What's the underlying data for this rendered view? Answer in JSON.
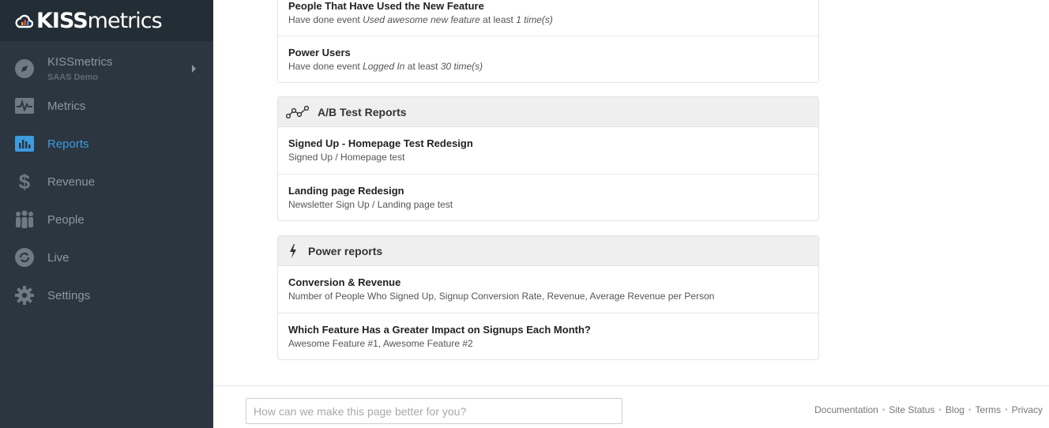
{
  "brand": {
    "name_bold": "KISS",
    "name_light": "metrics"
  },
  "sidebar": {
    "account": {
      "name": "KISSmetrics",
      "sub": "SAAS Demo"
    },
    "items": [
      {
        "label": "Metrics",
        "icon": "metrics-icon"
      },
      {
        "label": "Reports",
        "icon": "reports-icon",
        "active": true
      },
      {
        "label": "Revenue",
        "icon": "dollar-icon"
      },
      {
        "label": "People",
        "icon": "people-icon"
      },
      {
        "label": "Live",
        "icon": "live-icon"
      },
      {
        "label": "Settings",
        "icon": "gear-icon"
      }
    ],
    "colors": {
      "bg": "#2b3640",
      "active": "#3d9be0",
      "text": "#8c979f"
    }
  },
  "segments": {
    "rows": [
      {
        "title": "People That Have Used the New Feature",
        "pre": "Have done event ",
        "event": "Used awesome new feature",
        "mid": " at least ",
        "count": "1 time(s)"
      },
      {
        "title": "Power Users",
        "pre": "Have done event ",
        "event": "Logged In",
        "mid": " at least ",
        "count": "30 time(s)"
      }
    ]
  },
  "ab_tests": {
    "title": "A/B Test Reports",
    "rows": [
      {
        "title": "Signed Up - Homepage Test Redesign",
        "desc": "Signed Up / Homepage test"
      },
      {
        "title": "Landing page Redesign",
        "desc": "Newsletter Sign Up / Landing page test"
      }
    ]
  },
  "power_reports": {
    "title": "Power reports",
    "rows": [
      {
        "title": "Conversion & Revenue",
        "desc": "Number of People Who Signed Up, Signup Conversion Rate, Revenue, Average Revenue per Person"
      },
      {
        "title": "Which Feature Has a Greater Impact on Signups Each Month?",
        "desc": "Awesome Feature #1, Awesome Feature #2"
      }
    ]
  },
  "footer": {
    "feedback_placeholder": "How can we make this page better for you?",
    "links": [
      "Documentation",
      "Site Status",
      "Blog",
      "Terms",
      "Privacy"
    ]
  }
}
